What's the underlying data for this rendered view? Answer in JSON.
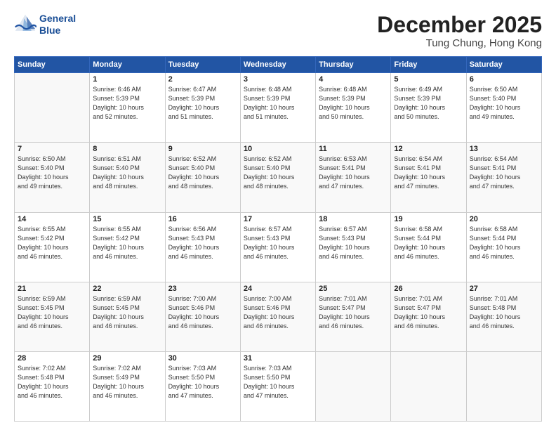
{
  "logo": {
    "line1": "General",
    "line2": "Blue"
  },
  "header": {
    "month": "December 2025",
    "location": "Tung Chung, Hong Kong"
  },
  "days_of_week": [
    "Sunday",
    "Monday",
    "Tuesday",
    "Wednesday",
    "Thursday",
    "Friday",
    "Saturday"
  ],
  "weeks": [
    [
      {
        "day": "",
        "info": ""
      },
      {
        "day": "1",
        "info": "Sunrise: 6:46 AM\nSunset: 5:39 PM\nDaylight: 10 hours\nand 52 minutes."
      },
      {
        "day": "2",
        "info": "Sunrise: 6:47 AM\nSunset: 5:39 PM\nDaylight: 10 hours\nand 51 minutes."
      },
      {
        "day": "3",
        "info": "Sunrise: 6:48 AM\nSunset: 5:39 PM\nDaylight: 10 hours\nand 51 minutes."
      },
      {
        "day": "4",
        "info": "Sunrise: 6:48 AM\nSunset: 5:39 PM\nDaylight: 10 hours\nand 50 minutes."
      },
      {
        "day": "5",
        "info": "Sunrise: 6:49 AM\nSunset: 5:39 PM\nDaylight: 10 hours\nand 50 minutes."
      },
      {
        "day": "6",
        "info": "Sunrise: 6:50 AM\nSunset: 5:40 PM\nDaylight: 10 hours\nand 49 minutes."
      }
    ],
    [
      {
        "day": "7",
        "info": "Sunrise: 6:50 AM\nSunset: 5:40 PM\nDaylight: 10 hours\nand 49 minutes."
      },
      {
        "day": "8",
        "info": "Sunrise: 6:51 AM\nSunset: 5:40 PM\nDaylight: 10 hours\nand 48 minutes."
      },
      {
        "day": "9",
        "info": "Sunrise: 6:52 AM\nSunset: 5:40 PM\nDaylight: 10 hours\nand 48 minutes."
      },
      {
        "day": "10",
        "info": "Sunrise: 6:52 AM\nSunset: 5:40 PM\nDaylight: 10 hours\nand 48 minutes."
      },
      {
        "day": "11",
        "info": "Sunrise: 6:53 AM\nSunset: 5:41 PM\nDaylight: 10 hours\nand 47 minutes."
      },
      {
        "day": "12",
        "info": "Sunrise: 6:54 AM\nSunset: 5:41 PM\nDaylight: 10 hours\nand 47 minutes."
      },
      {
        "day": "13",
        "info": "Sunrise: 6:54 AM\nSunset: 5:41 PM\nDaylight: 10 hours\nand 47 minutes."
      }
    ],
    [
      {
        "day": "14",
        "info": "Sunrise: 6:55 AM\nSunset: 5:42 PM\nDaylight: 10 hours\nand 46 minutes."
      },
      {
        "day": "15",
        "info": "Sunrise: 6:55 AM\nSunset: 5:42 PM\nDaylight: 10 hours\nand 46 minutes."
      },
      {
        "day": "16",
        "info": "Sunrise: 6:56 AM\nSunset: 5:43 PM\nDaylight: 10 hours\nand 46 minutes."
      },
      {
        "day": "17",
        "info": "Sunrise: 6:57 AM\nSunset: 5:43 PM\nDaylight: 10 hours\nand 46 minutes."
      },
      {
        "day": "18",
        "info": "Sunrise: 6:57 AM\nSunset: 5:43 PM\nDaylight: 10 hours\nand 46 minutes."
      },
      {
        "day": "19",
        "info": "Sunrise: 6:58 AM\nSunset: 5:44 PM\nDaylight: 10 hours\nand 46 minutes."
      },
      {
        "day": "20",
        "info": "Sunrise: 6:58 AM\nSunset: 5:44 PM\nDaylight: 10 hours\nand 46 minutes."
      }
    ],
    [
      {
        "day": "21",
        "info": "Sunrise: 6:59 AM\nSunset: 5:45 PM\nDaylight: 10 hours\nand 46 minutes."
      },
      {
        "day": "22",
        "info": "Sunrise: 6:59 AM\nSunset: 5:45 PM\nDaylight: 10 hours\nand 46 minutes."
      },
      {
        "day": "23",
        "info": "Sunrise: 7:00 AM\nSunset: 5:46 PM\nDaylight: 10 hours\nand 46 minutes."
      },
      {
        "day": "24",
        "info": "Sunrise: 7:00 AM\nSunset: 5:46 PM\nDaylight: 10 hours\nand 46 minutes."
      },
      {
        "day": "25",
        "info": "Sunrise: 7:01 AM\nSunset: 5:47 PM\nDaylight: 10 hours\nand 46 minutes."
      },
      {
        "day": "26",
        "info": "Sunrise: 7:01 AM\nSunset: 5:47 PM\nDaylight: 10 hours\nand 46 minutes."
      },
      {
        "day": "27",
        "info": "Sunrise: 7:01 AM\nSunset: 5:48 PM\nDaylight: 10 hours\nand 46 minutes."
      }
    ],
    [
      {
        "day": "28",
        "info": "Sunrise: 7:02 AM\nSunset: 5:48 PM\nDaylight: 10 hours\nand 46 minutes."
      },
      {
        "day": "29",
        "info": "Sunrise: 7:02 AM\nSunset: 5:49 PM\nDaylight: 10 hours\nand 46 minutes."
      },
      {
        "day": "30",
        "info": "Sunrise: 7:03 AM\nSunset: 5:50 PM\nDaylight: 10 hours\nand 47 minutes."
      },
      {
        "day": "31",
        "info": "Sunrise: 7:03 AM\nSunset: 5:50 PM\nDaylight: 10 hours\nand 47 minutes."
      },
      {
        "day": "",
        "info": ""
      },
      {
        "day": "",
        "info": ""
      },
      {
        "day": "",
        "info": ""
      }
    ]
  ]
}
